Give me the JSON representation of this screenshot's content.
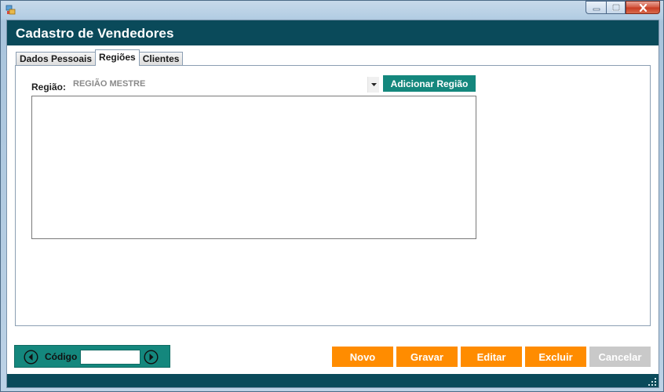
{
  "window": {
    "title": "Cadastro de Vendedores",
    "controls": [
      "minimize-icon",
      "maximize-icon",
      "close-icon"
    ]
  },
  "tabs": [
    {
      "label": "Dados Pessoais",
      "active": false
    },
    {
      "label": "Regiões",
      "active": true
    },
    {
      "label": "Clientes",
      "active": false
    }
  ],
  "regioes": {
    "label": "Região:",
    "selected": "REGIÃO MESTRE",
    "add_button": "Adicionar Região",
    "items": []
  },
  "navigator": {
    "prev_icon": "arrow-left-circle-icon",
    "label": "Código",
    "value": "",
    "next_icon": "arrow-right-circle-icon"
  },
  "actions": {
    "novo": "Novo",
    "gravar": "Gravar",
    "editar": "Editar",
    "excluir": "Excluir",
    "cancelar": "Cancelar",
    "cancelar_enabled": false
  },
  "colors": {
    "header": "#0a4a5a",
    "teal": "#14877d",
    "orange": "#ff8c00",
    "disabled": "#c9c9c9"
  }
}
